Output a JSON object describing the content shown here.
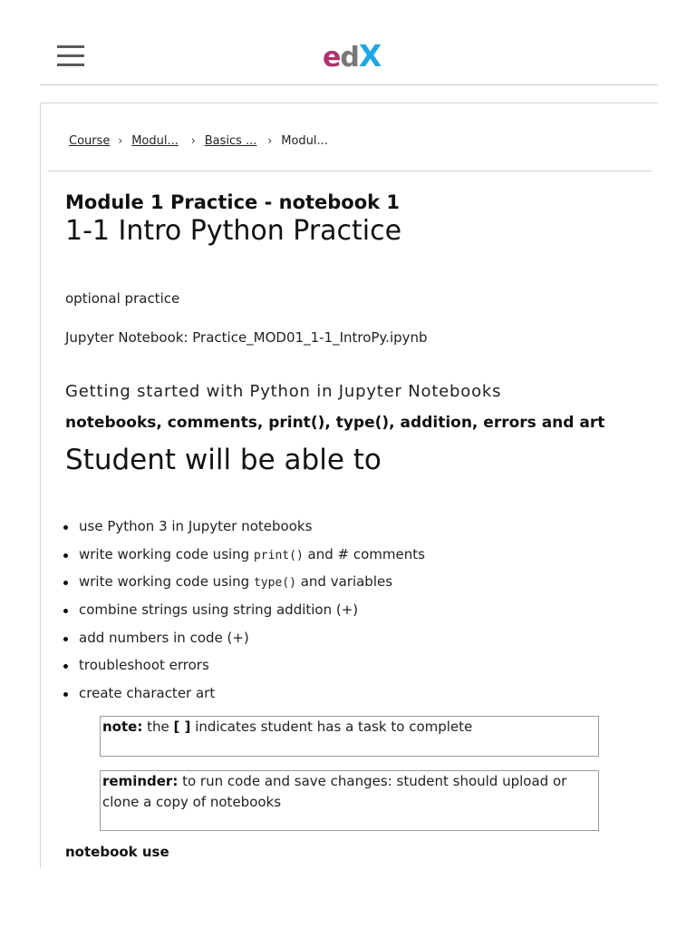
{
  "header": {
    "logo": {
      "e": "e",
      "d": "d",
      "x": "X"
    },
    "menu_icon": "hamburger-icon"
  },
  "breadcrumb": {
    "items": [
      "Course",
      "Modul...",
      "Basics ...",
      "Modul..."
    ],
    "separator": "›"
  },
  "page": {
    "subtitle": "Module 1 Practice - notebook 1",
    "title": "1-1 Intro Python Practice",
    "optional": "optional practice",
    "notebook_file": "Jupyter Notebook: Practice_MOD01_1-1_IntroPy.ipynb",
    "getting_started": "Getting started with Python in Jupyter Notebooks",
    "topics": "notebooks, comments, print(), type(), addition, errors and art",
    "student_heading": "Student will be able to",
    "objectives": [
      {
        "before": "use Python 3 in Jupyter notebooks",
        "code": "",
        "after": ""
      },
      {
        "before": "write working code using ",
        "code": "print()",
        "after": " and # comments"
      },
      {
        "before": "write working code using ",
        "code": "type()",
        "after": " and variables"
      },
      {
        "before": "combine strings using string addition (+)",
        "code": "",
        "after": ""
      },
      {
        "before": "add numbers in code (+)",
        "code": "",
        "after": ""
      },
      {
        "before": "troubleshoot errors",
        "code": "",
        "after": ""
      },
      {
        "before": "create character art",
        "code": "",
        "after": ""
      }
    ],
    "note": {
      "label": "note:",
      "text_a": " the ",
      "brackets": "[ ]",
      "text_b": " indicates student has a task to complete"
    },
    "reminder": {
      "label": "reminder:",
      "text": " to run code and save changes: student should upload or clone a copy of notebooks"
    },
    "notebook_use": "notebook use"
  },
  "colors": {
    "logo_e": "#b0326e",
    "logo_d": "#777777",
    "logo_x": "#1ea7e1"
  }
}
